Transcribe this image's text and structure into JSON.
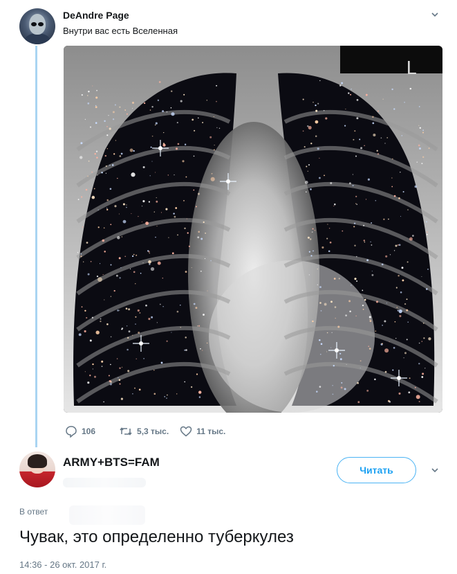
{
  "tweet": {
    "author_name": "DeAndre Page",
    "text": "Внутри вас есть Вселенная",
    "image_mark": "L",
    "actions": {
      "replies": "106",
      "retweets": "5,3 тыс.",
      "likes": "11 тыс."
    }
  },
  "reply": {
    "author_name": "ARMY+BTS=FAM",
    "follow_label": "Читать",
    "in_reply_label": "В ответ",
    "text": "Чувак, это определенно туберкулез",
    "timestamp": "14:36 - 26 окт. 2017 г."
  },
  "icons": {
    "reply": "speech-bubble-icon",
    "retweet": "retweet-icon",
    "like": "heart-icon",
    "more": "chevron-down-icon"
  },
  "colors": {
    "accent": "#1da1f2",
    "thread_line": "#a9d4f2",
    "muted": "#657786",
    "text": "#14171a"
  }
}
